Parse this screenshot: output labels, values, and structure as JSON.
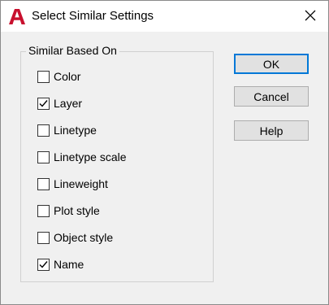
{
  "dialog": {
    "title": "Select Similar Settings",
    "app_icon": "autocad-a-icon",
    "close_icon": "close-x-icon",
    "accent_color": "#0078d7",
    "icon_color": "#c8102e"
  },
  "group": {
    "label": "Similar Based On",
    "items": [
      {
        "label": "Color",
        "checked": false
      },
      {
        "label": "Layer",
        "checked": true
      },
      {
        "label": "Linetype",
        "checked": false
      },
      {
        "label": "Linetype scale",
        "checked": false
      },
      {
        "label": "Lineweight",
        "checked": false
      },
      {
        "label": "Plot style",
        "checked": false
      },
      {
        "label": "Object style",
        "checked": false
      },
      {
        "label": "Name",
        "checked": true
      }
    ]
  },
  "buttons": {
    "ok": "OK",
    "cancel": "Cancel",
    "help": "Help"
  }
}
